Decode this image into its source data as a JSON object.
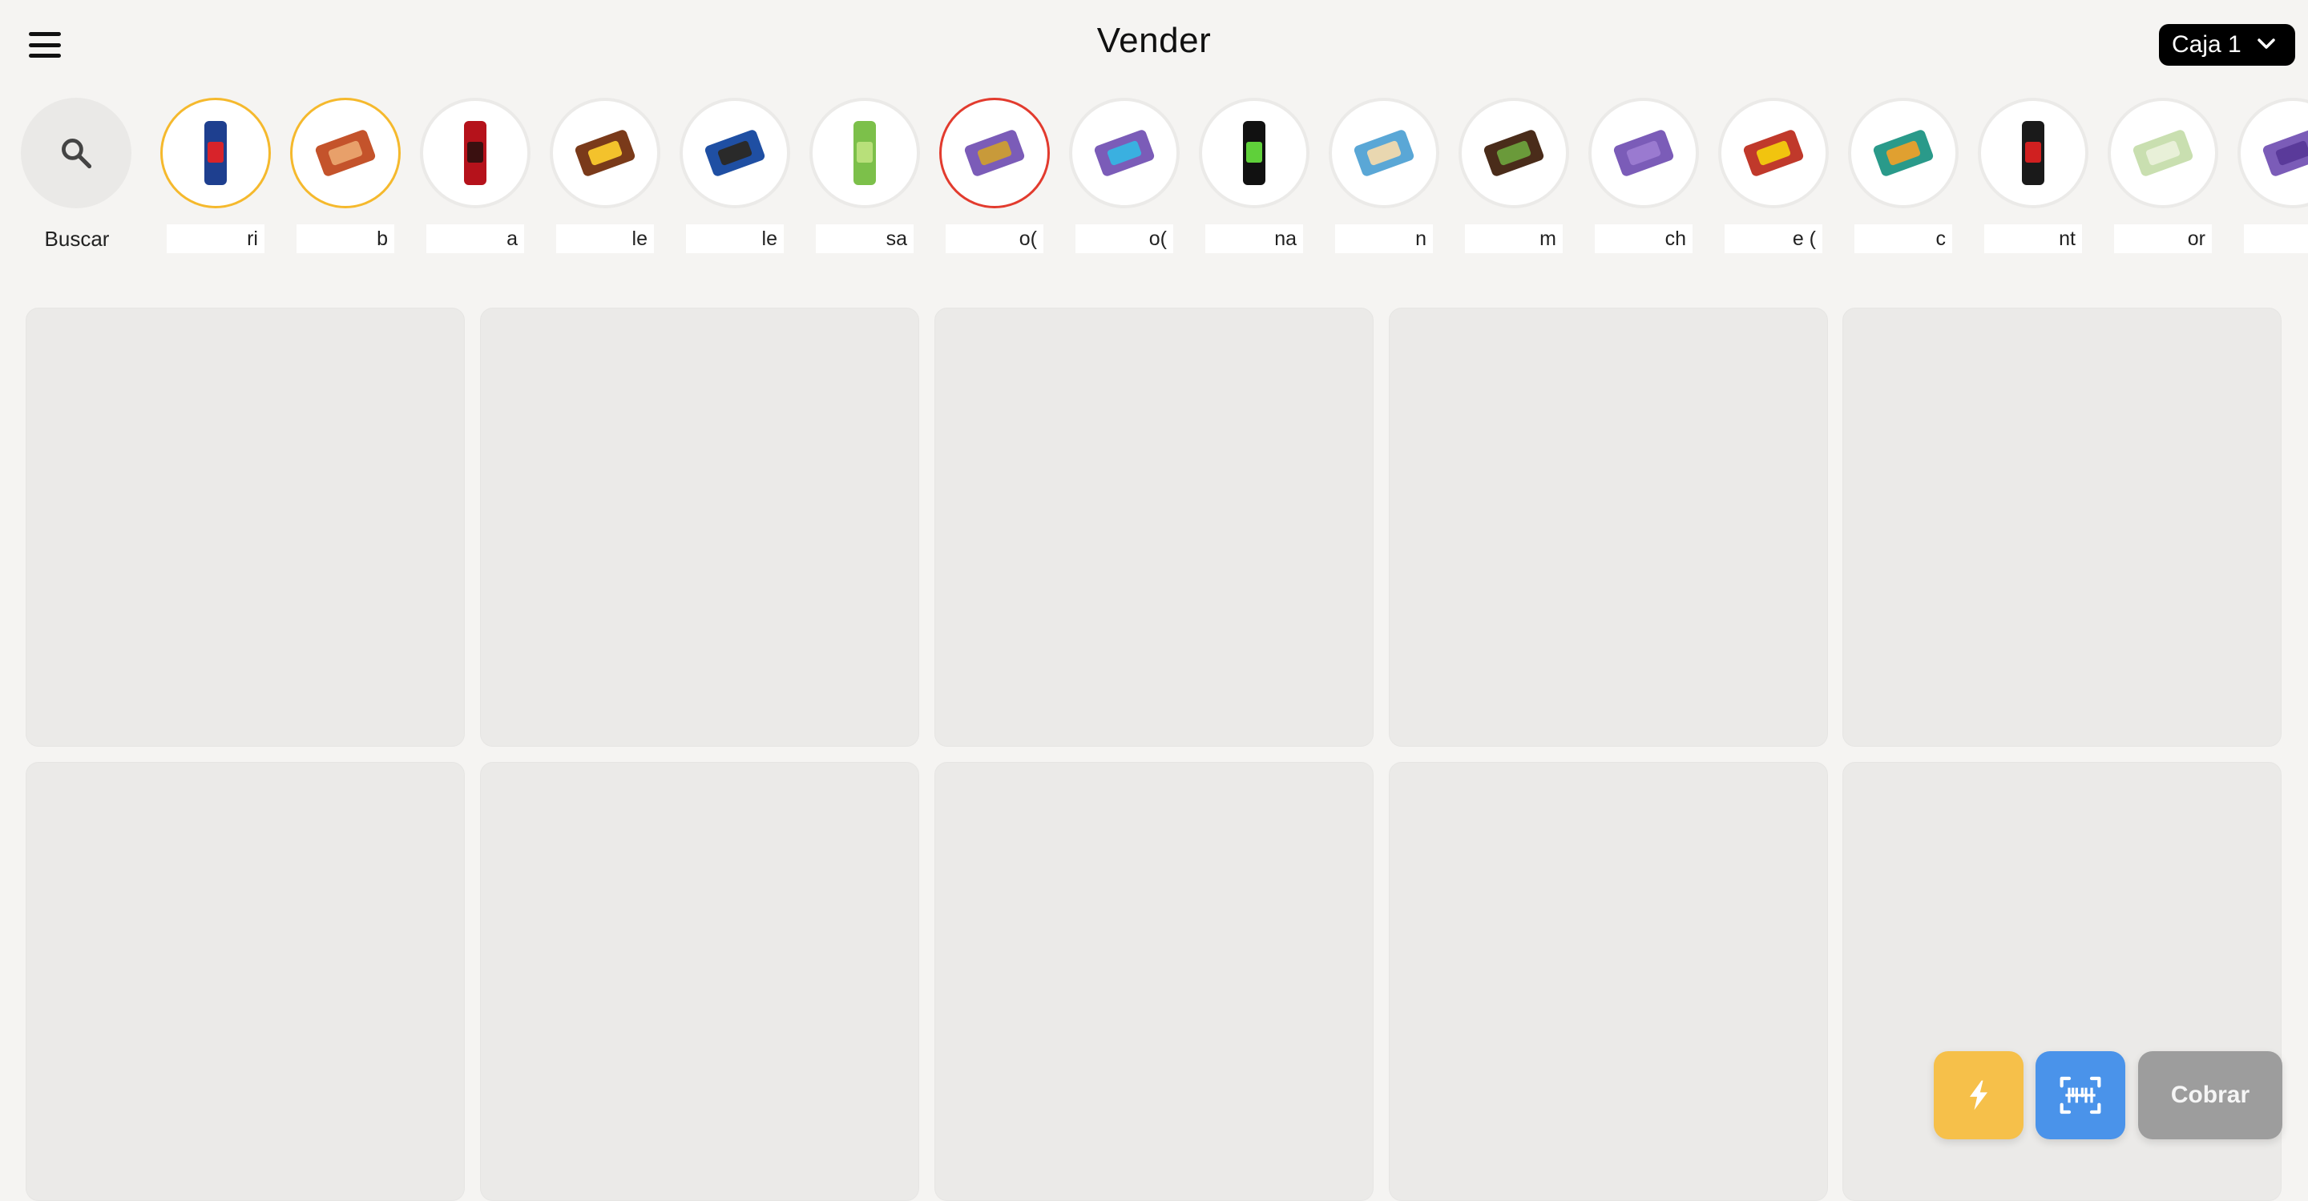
{
  "header": {
    "title": "Vender",
    "register_select": {
      "value": "Caja 1"
    }
  },
  "quick_products": {
    "search_label": "Buscar",
    "items": [
      {
        "label": "ri",
        "icon": "red-bull-can-icon",
        "highlight": "yellow"
      },
      {
        "label": "b",
        "icon": "don-satur-pack-icon",
        "highlight": "yellow"
      },
      {
        "label": "a",
        "icon": "cola-bottle-icon",
        "highlight": "none"
      },
      {
        "label": "le",
        "icon": "shot-chocolate-bar-icon",
        "highlight": "none"
      },
      {
        "label": "le",
        "icon": "oreo-pack-icon",
        "highlight": "none"
      },
      {
        "label": "sa",
        "icon": "pringles-can-icon",
        "highlight": "none"
      },
      {
        "label": "o(",
        "icon": "milka-alfajor-icon",
        "highlight": "red"
      },
      {
        "label": "o(",
        "icon": "milka-mousse-icon",
        "highlight": "none"
      },
      {
        "label": "na",
        "icon": "monster-can-icon",
        "highlight": "none"
      },
      {
        "label": "n",
        "icon": "mana-cookies-icon",
        "highlight": "none"
      },
      {
        "label": "m",
        "icon": "alfajor-chocolate-icon",
        "highlight": "none"
      },
      {
        "label": "ch",
        "icon": "milka-bar-icon",
        "highlight": "none"
      },
      {
        "label": "e (",
        "icon": "snack-bag-icon",
        "highlight": "none"
      },
      {
        "label": "c",
        "icon": "cereal-bar-icon",
        "highlight": "none"
      },
      {
        "label": "nt",
        "icon": "speed-can-icon",
        "highlight": "none"
      },
      {
        "label": "or",
        "icon": "wafer-pack-icon",
        "highlight": "none"
      },
      {
        "label": "",
        "icon": "milka-chocolate-icon",
        "highlight": "none"
      }
    ]
  },
  "actions": {
    "quick_icon": "lightning-icon",
    "scan_icon": "barcode-scan-icon",
    "charge_label": "Cobrar"
  },
  "colors": {
    "background": "#f5f4f2",
    "tile": "#ebeae8",
    "quick_button": "#f6c04a",
    "scan_button": "#4a93ea",
    "charge_button": "#9d9d9d",
    "highlight_yellow": "#f5b92d",
    "highlight_red": "#e23b2e"
  }
}
